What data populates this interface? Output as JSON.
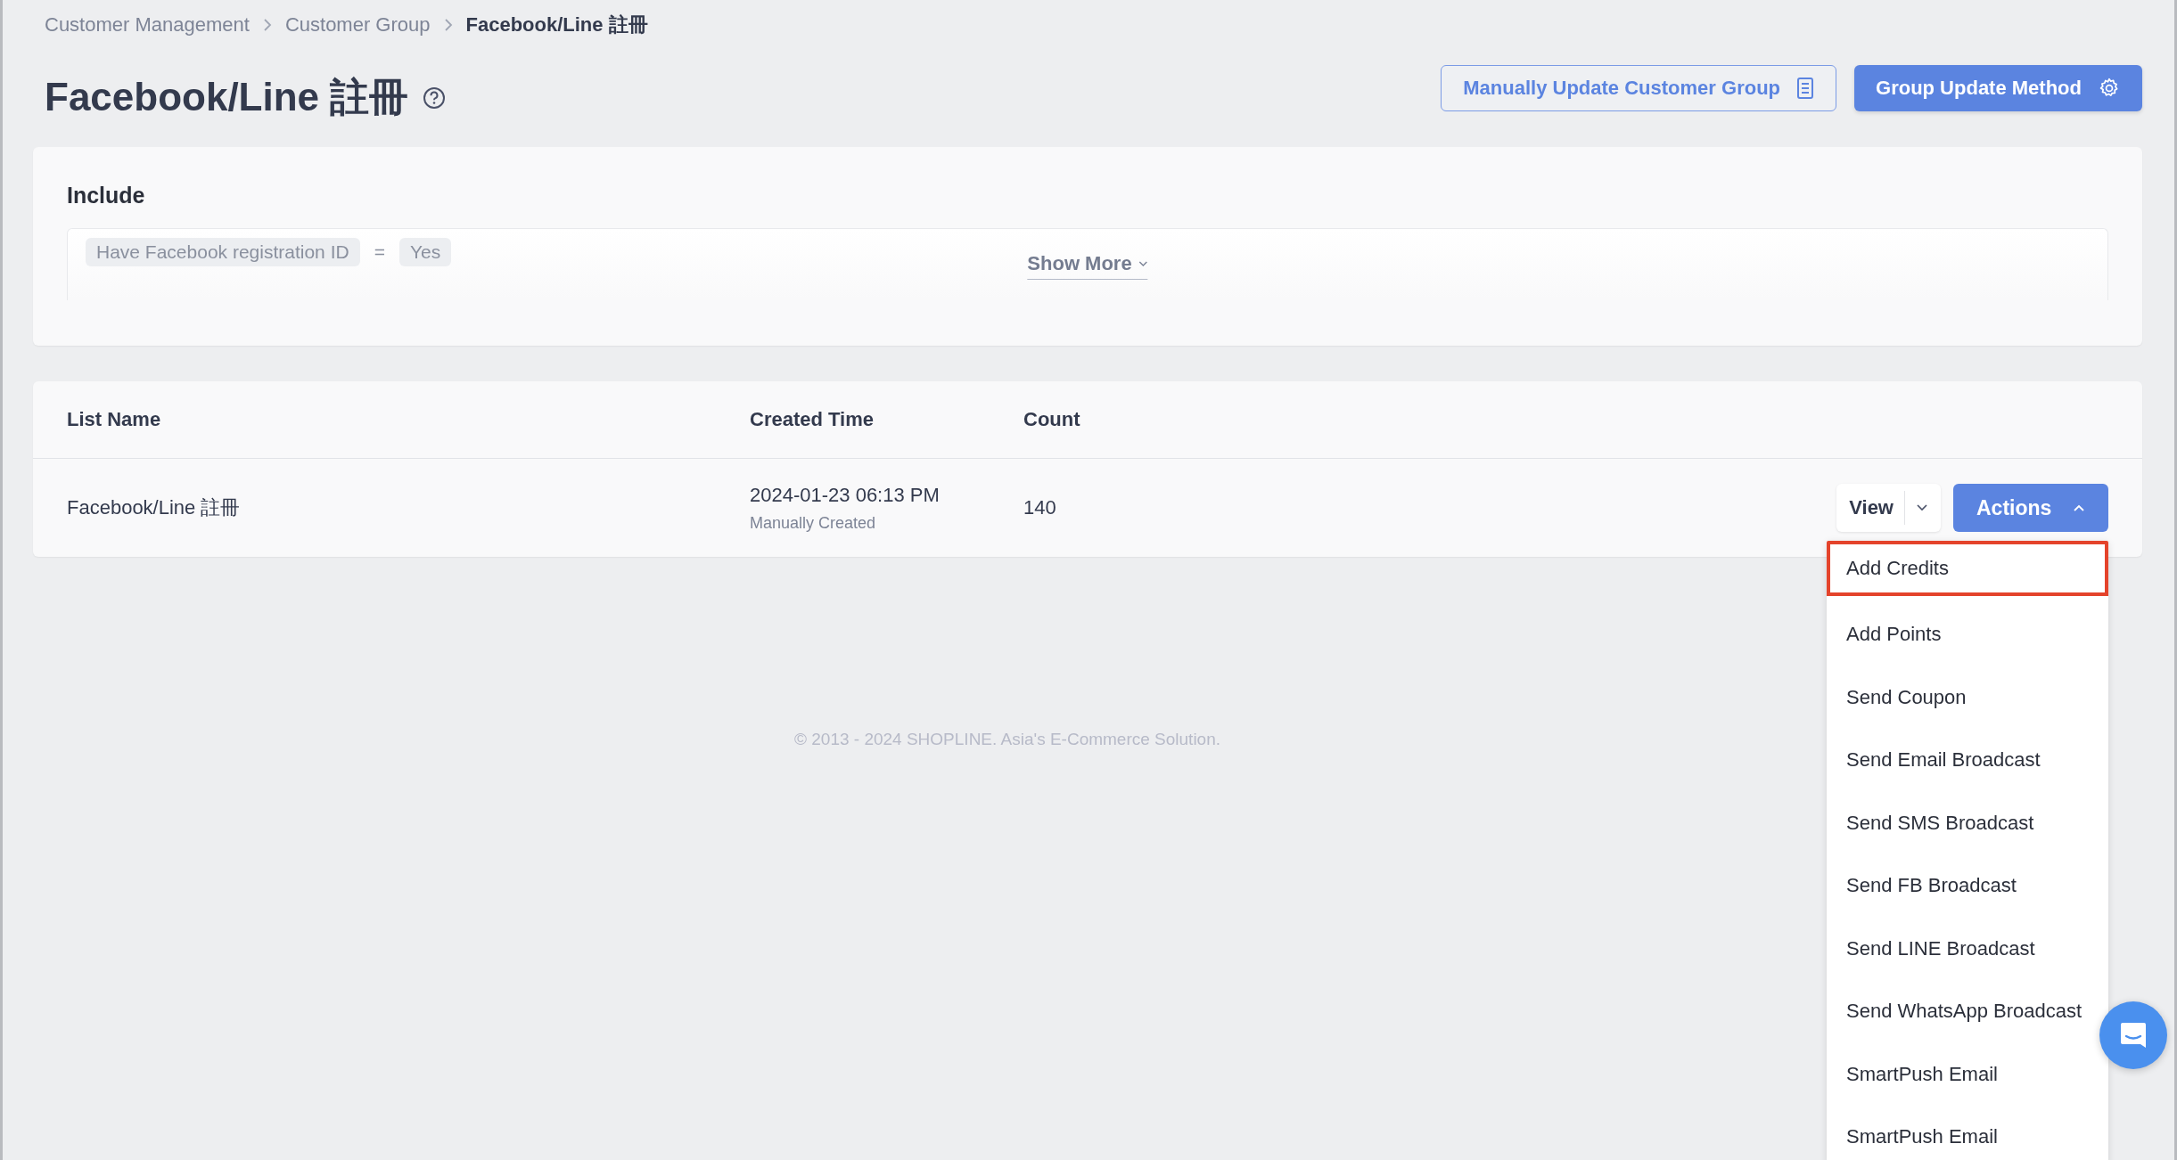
{
  "breadcrumb": [
    {
      "label": "Customer Management",
      "current": false
    },
    {
      "label": "Customer Group",
      "current": false
    },
    {
      "label": "Facebook/Line 註冊",
      "current": true
    }
  ],
  "title": "Facebook/Line 註冊",
  "header_buttons": [
    {
      "label": "Manually Update Customer Group",
      "kind": "outline"
    },
    {
      "label": "Group Update Method",
      "kind": "primary"
    }
  ],
  "include": {
    "title": "Include",
    "conditions": [
      {
        "field": "Have Facebook registration ID",
        "operator": "=",
        "value": "Yes"
      }
    ],
    "show_more": "Show More"
  },
  "table": {
    "columns": [
      "List Name",
      "Created Time",
      "Count"
    ],
    "rows": [
      {
        "list_name": "Facebook/Line 註冊",
        "created_time": "2024-01-23 06:13 PM",
        "created_note": "Manually Created",
        "count": "140",
        "view_button": "View",
        "actions_button": "Actions",
        "actions_expanded": true
      }
    ]
  },
  "actions_menu": [
    {
      "label": "Add Credits",
      "selected": true
    },
    {
      "label": "Add Points",
      "selected": false
    },
    {
      "label": "Send Coupon",
      "selected": false
    },
    {
      "label": "Send Email Broadcast",
      "selected": false
    },
    {
      "label": "Send SMS Broadcast",
      "selected": false
    },
    {
      "label": "Send FB Broadcast",
      "selected": false
    },
    {
      "label": "Send LINE Broadcast",
      "selected": false
    },
    {
      "label": "Send WhatsApp Broadcast",
      "selected": false
    },
    {
      "label": "SmartPush Email",
      "selected": false
    },
    {
      "label": "SmartPush Email",
      "selected": false
    }
  ],
  "footer": "© 2013 - 2024 SHOPLINE. Asia's E-Commerce Solution."
}
